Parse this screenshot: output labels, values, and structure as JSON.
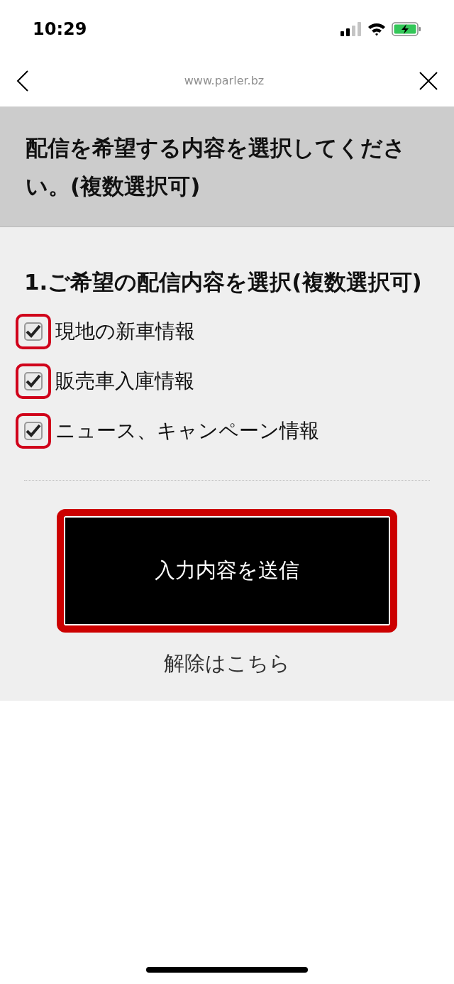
{
  "status_bar": {
    "time": "10:29"
  },
  "browser_bar": {
    "url": "www.parler.bz"
  },
  "header": {
    "title": "配信を希望する内容を選択してください。(複数選択可)"
  },
  "section": {
    "heading": "1.ご希望の配信内容を選択(複数選択可)"
  },
  "options": [
    {
      "label": "現地の新車情報",
      "checked": true,
      "highlighted": true
    },
    {
      "label": "販売車入庫情報",
      "checked": true,
      "highlighted": true
    },
    {
      "label": "ニュース、キャンペーン情報",
      "checked": true,
      "highlighted": true
    }
  ],
  "submit_button": {
    "label": "入力内容を送信",
    "highlighted": true
  },
  "unsubscribe_link": {
    "label": "解除はこちら"
  }
}
